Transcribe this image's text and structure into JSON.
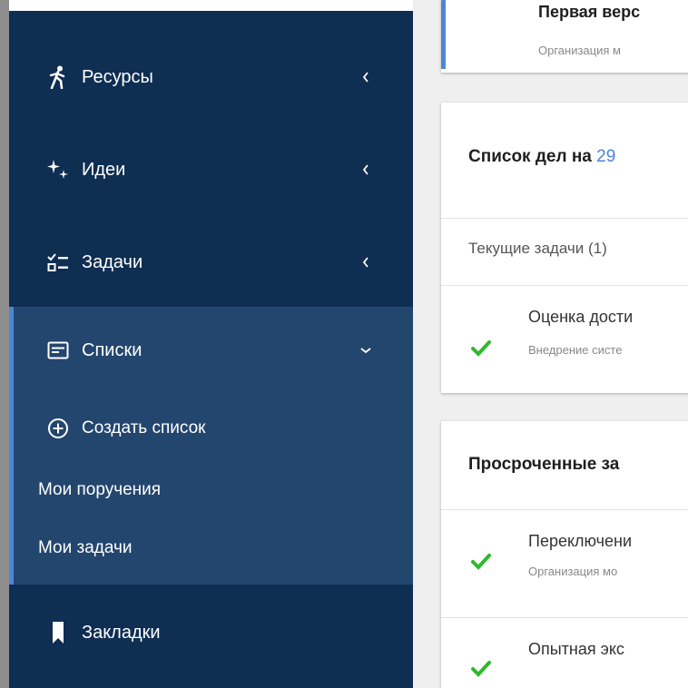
{
  "sidebar": {
    "items": [
      {
        "label": "Ресурсы",
        "icon": "person-walking-icon"
      },
      {
        "label": "Идеи",
        "icon": "sparkle-icon"
      },
      {
        "label": "Задачи",
        "icon": "checklist-icon"
      },
      {
        "label": "Списки",
        "icon": "list-icon"
      }
    ],
    "lists_submenu": [
      {
        "label": "Создать список",
        "icon": "plus-circle-icon"
      },
      {
        "label": "Мои поручения"
      },
      {
        "label": "Мои задачи"
      }
    ],
    "bookmarks": {
      "label": "Закладки",
      "icon": "bookmark-icon"
    }
  },
  "main": {
    "top_card": {
      "title": "Первая верс",
      "subtitle": "Организация м"
    },
    "todo_card": {
      "title_prefix": "Список дел на",
      "date": "29",
      "current_section": "Текущие задачи (1)",
      "current_tasks": [
        {
          "title": "Оценка дости",
          "subtitle": "Внедрение систе"
        }
      ]
    },
    "overdue_card": {
      "title": "Просроченные за",
      "tasks": [
        {
          "title": "Переключени",
          "subtitle": "Организация мо"
        },
        {
          "title": "Опытная экс",
          "subtitle": ""
        }
      ]
    }
  },
  "colors": {
    "sidebar_bg": "#0e2e52",
    "sidebar_expanded_bg": "#23466e",
    "accent": "#4d86d4",
    "check": "#2eb82e"
  }
}
